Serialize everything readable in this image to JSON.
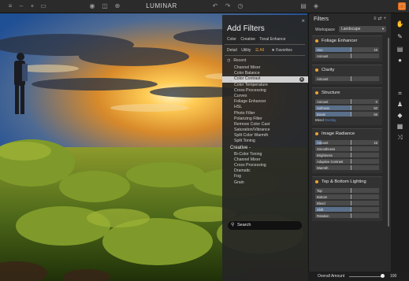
{
  "app": {
    "title": "LUMINAR"
  },
  "add_filters": {
    "title": "Add Filters",
    "tabs_row1": [
      "Color",
      "Creative",
      "Tonal Enhance"
    ],
    "tabs_row2": [
      "Detail",
      "Utility",
      "All",
      "Favorites"
    ],
    "recent_label": "Recent",
    "recent_items": [
      "Channel Mixer",
      "Color Balance",
      "Color Contrast",
      "Color Temperature",
      "Cross Processing",
      "Curves",
      "Foliage Enhancer",
      "HSL",
      "Photo Filter",
      "Polarizing Filter",
      "Remove Color Cast",
      "Saturation/Vibrance",
      "Split Color Warmth",
      "Split Toning"
    ],
    "selected_item": "Color Contrast",
    "creative_label": "Creative -",
    "creative_items": [
      "Bi-Color Toning",
      "Channel Mixer",
      "Cross Processing",
      "Dramatic",
      "Fog",
      "Grain"
    ],
    "search_placeholder": "Search"
  },
  "filters_panel": {
    "title": "Filters",
    "workspace_label": "Workspace",
    "workspace_value": "Landscape",
    "sections": [
      {
        "title": "Foliage Enhancer",
        "rows": [
          {
            "label": "Hue",
            "value": "15",
            "fill": 0.55
          },
          {
            "label": "Amount",
            "value": "",
            "fill": 0
          }
        ]
      },
      {
        "title": "Clarity",
        "rows": [
          {
            "label": "Amount",
            "value": "",
            "fill": 0
          }
        ]
      },
      {
        "title": "Structure",
        "rows": [
          {
            "label": "Amount",
            "value": "0",
            "fill": 0
          },
          {
            "label": "Softness",
            "value": "50",
            "fill": 0.55
          },
          {
            "label": "Boost",
            "value": "56",
            "fill": 0.55
          }
        ],
        "blend": {
          "label": "Blend",
          "link": "Overlay"
        }
      },
      {
        "title": "Image Radiance",
        "rows": [
          {
            "label": "Amount",
            "value": "15",
            "fill": 0.1
          },
          {
            "label": "Smoothness",
            "value": "",
            "fill": 0
          },
          {
            "label": "Brightness",
            "value": "",
            "fill": 0
          },
          {
            "label": "Adaptive Contrast",
            "value": "",
            "fill": 0
          },
          {
            "label": "Warmth",
            "value": "",
            "fill": 0
          }
        ]
      },
      {
        "title": "Top & Bottom Lighting",
        "rows": [
          {
            "label": "Top",
            "value": "",
            "fill": 0
          },
          {
            "label": "Bottom",
            "value": "",
            "fill": 0
          },
          {
            "label": "Blend",
            "value": "",
            "fill": 0
          },
          {
            "label": "Shift",
            "value": "",
            "fill": 0.55
          },
          {
            "label": "Rotation",
            "value": "",
            "fill": 0
          }
        ]
      }
    ]
  },
  "bottom": {
    "overall_label": "Overall Amount",
    "overall_value": "100"
  },
  "colors": {
    "accent_orange": "#e8a33a",
    "slider_fill": "#5a6f8a",
    "link_blue": "#5c8ed8"
  }
}
